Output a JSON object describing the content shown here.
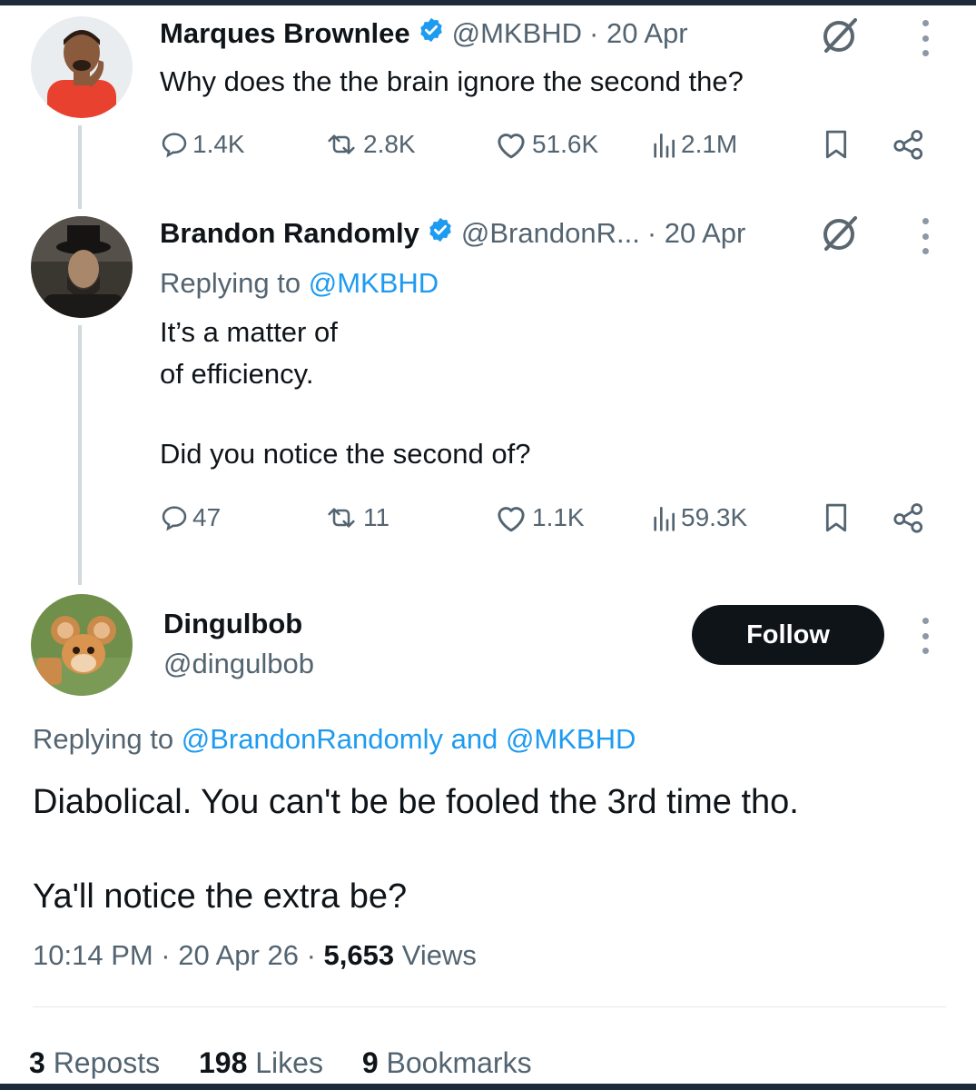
{
  "tweet1": {
    "name": "Marques Brownlee",
    "handle": "@MKBHD",
    "time": "· 20 Apr",
    "text": "Why does the the brain ignore the second the?",
    "replies": "1.4K",
    "reposts": "2.8K",
    "likes": "51.6K",
    "views": "2.1M"
  },
  "tweet2": {
    "name": "Brandon Randomly",
    "handle": "@BrandonR...",
    "time": "· 20 Apr",
    "replying_prefix": "Replying to",
    "replying_to": "@MKBHD",
    "line1": "It’s a matter of",
    "line2": "of efficiency.",
    "line3": "Did you notice the second of?",
    "replies": "47",
    "reposts": "11",
    "likes": "1.1K",
    "views": "59.3K"
  },
  "tweet3": {
    "name": "Dingulbob",
    "handle": "@dingulbob",
    "follow_label": "Follow",
    "replying_prefix": "Replying to",
    "replying_to1": "@BrandonRandomly",
    "replying_and": "and",
    "replying_to2": "@MKBHD",
    "line1": "Diabolical. You can't be be fooled the 3rd time tho.",
    "line2": "Ya'll notice the extra be?",
    "time": "10:14 PM · 20 Apr 26 ·",
    "views_count": "5,653",
    "views_label": "Views",
    "reposts_count": "3",
    "reposts_label": "Reposts",
    "likes_count": "198",
    "likes_label": "Likes",
    "bookmarks_count": "9",
    "bookmarks_label": "Bookmarks"
  },
  "colors": {
    "text": "#0f1419",
    "muted": "#536471",
    "link": "#1d9bf0",
    "verified": "#1d9bf0",
    "follow_bg": "#0f1419"
  },
  "icons": [
    "verified-badge-icon",
    "grok-icon",
    "more-icon",
    "reply-icon",
    "repost-icon",
    "like-icon",
    "views-icon",
    "bookmark-icon",
    "share-icon"
  ]
}
